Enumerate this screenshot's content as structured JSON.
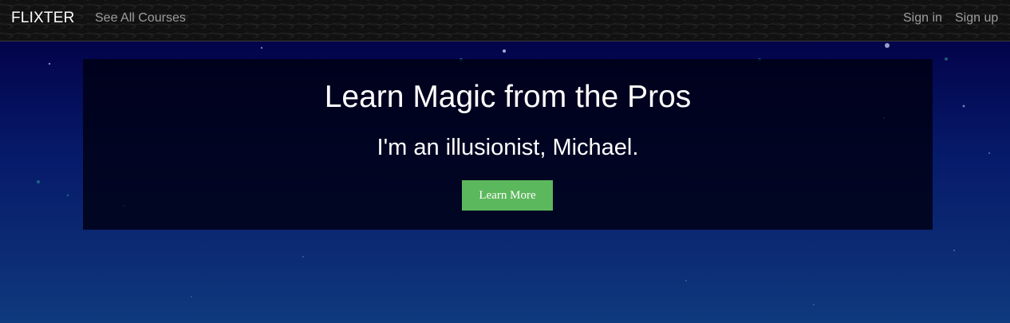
{
  "navbar": {
    "brand": "FLIXTER",
    "links": {
      "courses": "See All Courses",
      "sign_in": "Sign in",
      "sign_up": "Sign up"
    },
    "text_color": "#9d9d9d"
  },
  "hero": {
    "headline": "Learn Magic from the Pros",
    "subheadline": "I'm an illusionist, Michael.",
    "cta_label": "Learn More",
    "cta_color": "#5cb85c"
  }
}
